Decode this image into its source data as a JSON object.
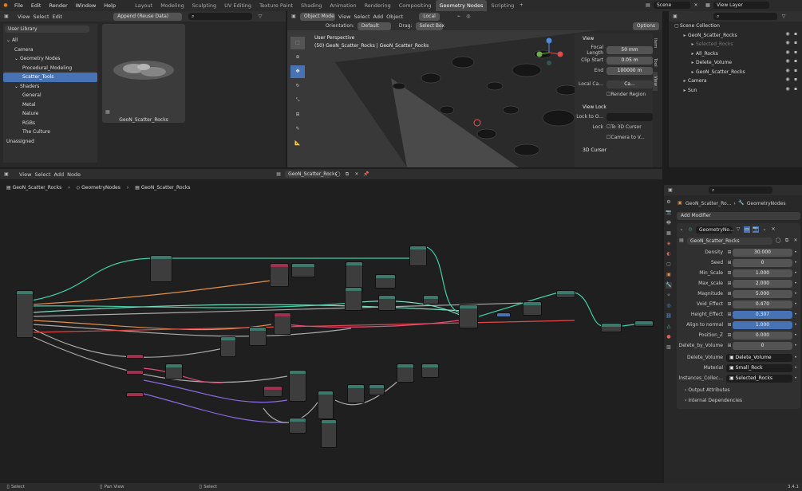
{
  "topbar": {
    "menus": [
      "File",
      "Edit",
      "Render",
      "Window",
      "Help"
    ],
    "workspaces": [
      "Layout",
      "Modeling",
      "Sculpting",
      "UV Editing",
      "Texture Paint",
      "Shading",
      "Animation",
      "Rendering",
      "Compositing",
      "Geometry Nodes",
      "Scripting"
    ],
    "active_workspace": "Geometry Nodes",
    "scene": "Scene",
    "view_layer": "View Layer"
  },
  "asset_browser": {
    "menus": [
      "View",
      "Select",
      "Edit"
    ],
    "import_mode": "Append (Reuse Data)",
    "library": "User Library",
    "catalogs": [
      {
        "label": "All",
        "indent": 0
      },
      {
        "label": "Camera",
        "indent": 1
      },
      {
        "label": "Geometry Nodes",
        "indent": 1
      },
      {
        "label": "Procedural_Modeling",
        "indent": 2
      },
      {
        "label": "Scatter_Tools",
        "indent": 2,
        "selected": true
      },
      {
        "label": "Shaders",
        "indent": 1
      },
      {
        "label": "General",
        "indent": 2
      },
      {
        "label": "Metal",
        "indent": 2
      },
      {
        "label": "Nature",
        "indent": 2
      },
      {
        "label": "RGBs",
        "indent": 2
      },
      {
        "label": "The Culture",
        "indent": 2
      },
      {
        "label": "Unassigned",
        "indent": 0
      }
    ],
    "asset_name": "GeoN_Scatter_Rocks"
  },
  "viewport": {
    "mode": "Object Mode",
    "menus": [
      "View",
      "Select",
      "Add",
      "Object"
    ],
    "transform": "Local",
    "orientation_label": "Orientation:",
    "orientation": "Default",
    "drag_label": "Drag:",
    "drag": "Select Box",
    "options": "Options",
    "overlay_title": "User Perspective",
    "overlay_sub": "(50) GeoN_Scatter_Rocks | GeoN_Scatter_Rocks",
    "npanel": {
      "view_title": "View",
      "focal_length_label": "Focal Length",
      "focal_length": "50 mm",
      "clip_start_label": "Clip Start",
      "clip_start": "0.05 m",
      "end_label": "End",
      "end": "100000 m",
      "local_camera_label": "Local Ca...",
      "local_camera": "Ca...",
      "render_region": "Render Region",
      "view_lock_title": "View Lock",
      "lock_to_obj_label": "Lock to O...",
      "lock_label": "Lock",
      "to_3d_cursor": "To 3D Cursor",
      "camera_to_view": "Camera to V...",
      "cursor_title": "3D Cursor",
      "tabs": [
        "Item",
        "Tool",
        "View"
      ]
    }
  },
  "outliner": {
    "root": "Scene Collection",
    "items": [
      {
        "label": "GeoN_Scatter_Rocks",
        "indent": 1
      },
      {
        "label": "Selected_Rocks",
        "indent": 2,
        "dim": true
      },
      {
        "label": "All_Rocks",
        "indent": 2
      },
      {
        "label": "Delete_Volume",
        "indent": 2
      },
      {
        "label": "GeoN_Scatter_Rocks",
        "indent": 2
      },
      {
        "label": "Camera",
        "indent": 1
      },
      {
        "label": "Sun",
        "indent": 1
      }
    ]
  },
  "node_editor": {
    "menus": [
      "View",
      "Select",
      "Add",
      "Node"
    ],
    "tree_name": "GeoN_Scatter_Rocks",
    "breadcrumbs": [
      "GeoN_Scatter_Rocks",
      "GeometryNodes",
      "GeoN_Scatter_Rocks"
    ]
  },
  "properties": {
    "breadcrumb_obj": "GeoN_Scatter_Ro...",
    "breadcrumb_mod": "GeometryNodes",
    "add_modifier": "Add Modifier",
    "modifier_name": "GeometryNo...",
    "node_group": "GeoN_Scatter_Rocks",
    "params": [
      {
        "label": "Density",
        "value": "30.000",
        "blue": false
      },
      {
        "label": "Seed",
        "value": "0",
        "blue": false
      },
      {
        "label": "Min_Scale",
        "value": "1.000",
        "blue": false
      },
      {
        "label": "Max_scale",
        "value": "2.000",
        "blue": false
      },
      {
        "label": "Magnitude",
        "value": "5.000",
        "blue": false
      },
      {
        "label": "Void_Effect",
        "value": "0.470",
        "blue": false
      },
      {
        "label": "Height_Effect",
        "value": "0.307",
        "blue": true
      },
      {
        "label": "Align to normal",
        "value": "1.000",
        "blue": true
      },
      {
        "label": "Position_Z",
        "value": "0.000",
        "blue": false
      },
      {
        "label": "Delete_by_Volume",
        "value": "0",
        "blue": false
      }
    ],
    "objects": [
      {
        "label": "Delete_Volume",
        "value": "Delete_Volume"
      },
      {
        "label": "Material",
        "value": "Small_Rock"
      },
      {
        "label": "Instances_Collec...",
        "value": "Selected_Rocks"
      }
    ],
    "output_attributes": "Output Attributes",
    "internal_dependencies": "Internal Dependencies"
  },
  "statusbar": {
    "left": "Select",
    "middle": "Pan View",
    "right": "Select",
    "version": "3.4.1"
  }
}
